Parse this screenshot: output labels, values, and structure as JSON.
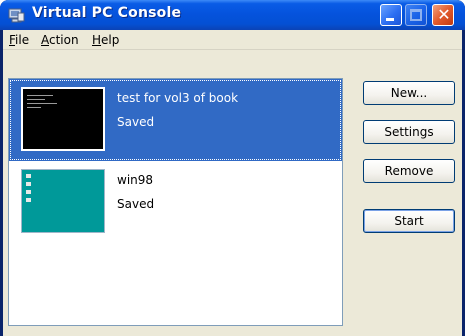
{
  "window": {
    "title": "Virtual PC Console",
    "app_icon": "virtual-pc-icon",
    "controls": [
      "minimize-icon",
      "maximize-icon",
      "close-icon"
    ],
    "close_glyph": "✕"
  },
  "menu": {
    "items": [
      {
        "label": "File",
        "accel": "F",
        "rest": "ile"
      },
      {
        "label": "Action",
        "accel": "A",
        "rest": "ction"
      },
      {
        "label": "Help",
        "accel": "H",
        "rest": "elp"
      }
    ]
  },
  "vms": [
    {
      "name": "test for vol3 of book",
      "status": "Saved",
      "selected": true,
      "thumbnail": "black-console-screen"
    },
    {
      "name": "win98",
      "status": "Saved",
      "selected": false,
      "thumbnail": "teal-desktop-screen"
    }
  ],
  "buttons": {
    "new_label": "New...",
    "settings_label": "Settings",
    "remove_label": "Remove",
    "start_label": "Start"
  },
  "colors": {
    "selection": "#316ac5",
    "titlebar": "#0553dd",
    "desktop_teal": "#009999",
    "client_bg": "#ece9d8"
  }
}
